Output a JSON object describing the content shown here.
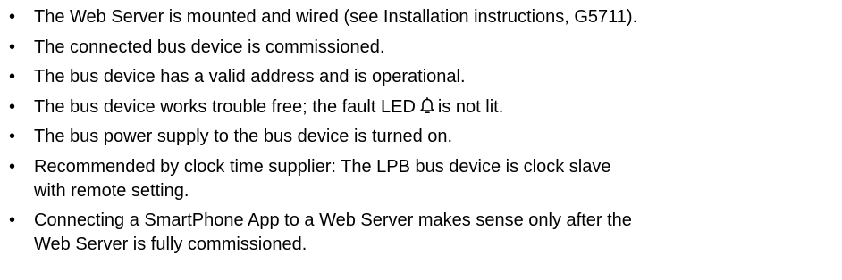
{
  "prerequisites": {
    "items": [
      {
        "text": "The Web Server is mounted and wired (see Installation instructions, G5711)."
      },
      {
        "text": "The connected bus device is commissioned."
      },
      {
        "text": "The bus device has a valid address and is operational."
      },
      {
        "before": "The bus device works trouble free; the fault LED",
        "icon": "bell-icon",
        "after": "is not lit."
      },
      {
        "text": "The bus power supply to the bus device is turned on."
      },
      {
        "line1": "Recommended by clock time supplier: The LPB bus device is clock slave",
        "line2": "with remote setting."
      },
      {
        "line1": "Connecting a SmartPhone App to a Web Server makes sense only after the",
        "line2": "Web Server is fully commissioned."
      }
    ],
    "bullet_glyph": "•"
  }
}
